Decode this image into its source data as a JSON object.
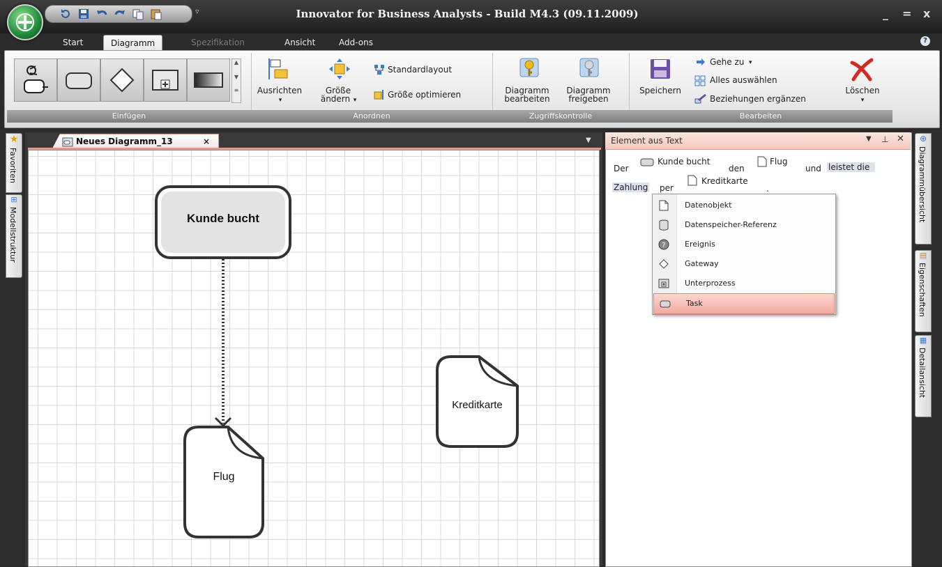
{
  "window": {
    "title": "Innovator for Business Analysts - Build M4.3 (09.11.2009)",
    "minimize": "_",
    "maximize": "=",
    "close": "x"
  },
  "ribbon_tabs": [
    {
      "label": "Start"
    },
    {
      "label": "Diagramm"
    },
    {
      "label": "Spezifikation"
    },
    {
      "label": "Ansicht"
    },
    {
      "label": "Add-ons"
    }
  ],
  "ribbon": {
    "einfuegen": {
      "label": "Einfügen"
    },
    "anordnen": {
      "label": "Anordnen",
      "ausrichten": "Ausrichten",
      "groesse_aendern_1": "Größe",
      "groesse_aendern_2": "ändern",
      "standardlayout": "Standardlayout",
      "groesse_optimieren": "Größe optimieren"
    },
    "zugriff": {
      "label": "Zugriffskontrolle",
      "bearbeiten_1": "Diagramm",
      "bearbeiten_2": "bearbeiten",
      "freigeben_1": "Diagramm",
      "freigeben_2": "freigeben"
    },
    "bearbeiten": {
      "label": "Bearbeiten",
      "speichern": "Speichern",
      "gehe_zu": "Gehe zu",
      "alles_auswaehlen": "Alles auswählen",
      "beziehungen": "Beziehungen ergänzen",
      "loeschen": "Löschen"
    }
  },
  "left_tabs": {
    "favoriten": "Favoriten",
    "modellstruktur": "Modellstruktur"
  },
  "right_tabs": {
    "diagrammuebersicht": "Diagrammübersicht",
    "eigenschaften": "Eigenschaften",
    "detailansicht": "Detailansicht"
  },
  "document_tab": {
    "label": "Neues Diagramm_13",
    "close": "×"
  },
  "diagram": {
    "task": "Kunde bucht",
    "doc1": "Flug",
    "doc2": "Kreditkarte"
  },
  "panel": {
    "title": "Element aus Text",
    "sentence": {
      "w_der": "Der",
      "w_kunde": "Kunde bucht",
      "w_den": "den",
      "w_flug": "Flug",
      "w_und": "und",
      "w_leistet": "leistet die",
      "w_zahlung": "Zahlung",
      "w_per": "per",
      "w_kredit": "Kreditkarte",
      "w_dot": "."
    }
  },
  "context_menu": {
    "items": [
      {
        "label": "Datenobjekt",
        "icon": "document-icon"
      },
      {
        "label": "Datenspeicher-Referenz",
        "icon": "datastore-icon"
      },
      {
        "label": "Ereignis",
        "icon": "event-icon"
      },
      {
        "label": "Gateway",
        "icon": "gateway-icon"
      },
      {
        "label": "Unterprozess",
        "icon": "subprocess-icon"
      },
      {
        "label": "Task",
        "icon": "task-icon"
      }
    ],
    "selected": "Task"
  }
}
